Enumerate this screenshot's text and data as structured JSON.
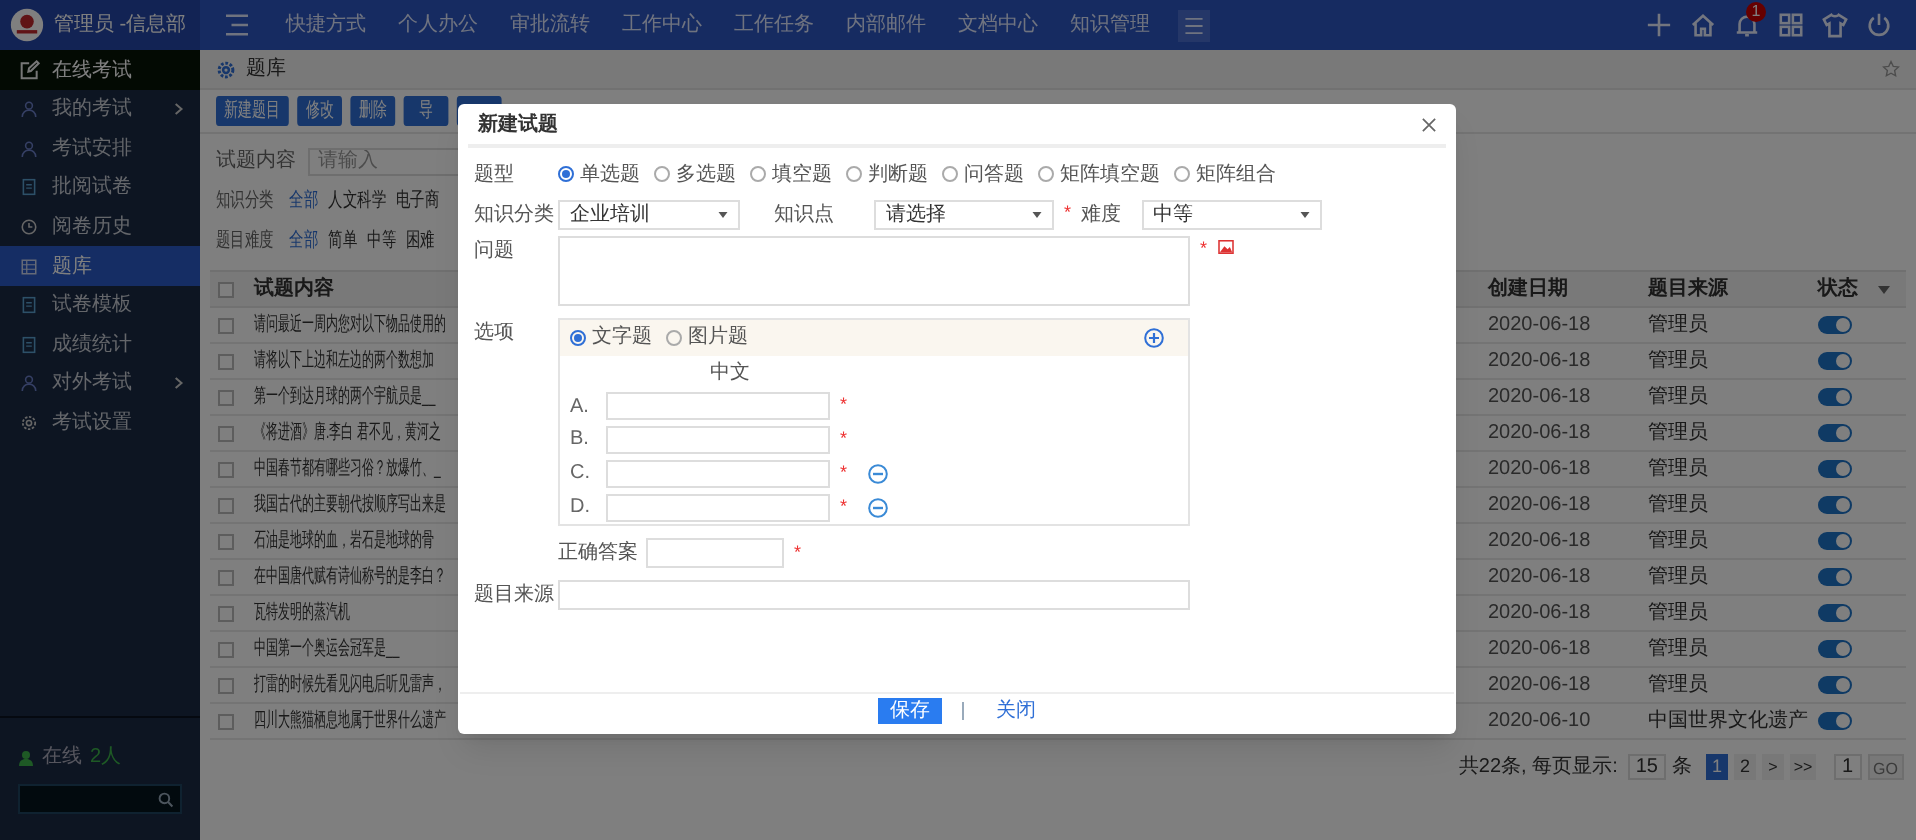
{
  "header": {
    "brand": "管理员 -信息部",
    "nav": [
      "快捷方式",
      "个人办公",
      "审批流转",
      "工作中心",
      "工作任务",
      "内部邮件",
      "文档中心",
      "知识管理"
    ],
    "notification_count": "1"
  },
  "sidebar": {
    "title": "在线考试",
    "items": [
      {
        "label": "我的考试",
        "expandable": true,
        "selected": false
      },
      {
        "label": "考试安排",
        "expandable": false,
        "selected": false
      },
      {
        "label": "批阅试卷",
        "expandable": false,
        "selected": false
      },
      {
        "label": "阅卷历史",
        "expandable": false,
        "selected": false
      },
      {
        "label": "题库",
        "expandable": false,
        "selected": true
      },
      {
        "label": "试卷模板",
        "expandable": false,
        "selected": false
      },
      {
        "label": "成绩统计",
        "expandable": false,
        "selected": false
      },
      {
        "label": "对外考试",
        "expandable": true,
        "selected": false
      },
      {
        "label": "考试设置",
        "expandable": false,
        "selected": false
      }
    ],
    "online_label": "在线",
    "online_count": "2人"
  },
  "breadcrumb": "题库",
  "toolbar": [
    {
      "label": "新建题目"
    },
    {
      "label": "修改"
    },
    {
      "label": "删除"
    },
    {
      "label": "导"
    }
  ],
  "filters": {
    "content_label": "试题内容",
    "content_placeholder": "请输入",
    "groups": [
      {
        "label": "知识分类",
        "options": [
          {
            "label": "全部",
            "selected": true
          },
          {
            "label": "人文科学",
            "selected": false
          },
          {
            "label": "电子商",
            "selected": false
          }
        ]
      },
      {
        "label": "题目难度",
        "options": [
          {
            "label": "全部",
            "selected": true
          },
          {
            "label": "简单",
            "selected": false
          },
          {
            "label": "中等",
            "selected": false
          },
          {
            "label": "困难",
            "selected": false
          }
        ]
      }
    ]
  },
  "table": {
    "all_checked": false,
    "columns": [
      "试题内容",
      "创建日期",
      "题目来源",
      "状态"
    ],
    "rows": [
      {
        "content": "请问最近一周内您对以下物品使用的",
        "date": "2020-06-18",
        "source": "管理员",
        "on": true,
        "checked": false
      },
      {
        "content": "请将以下上边和左边的两个数想加",
        "date": "2020-06-18",
        "source": "管理员",
        "on": true,
        "checked": false
      },
      {
        "content": "第一个到达月球的两个宇航员是__",
        "date": "2020-06-18",
        "source": "管理员",
        "on": true,
        "checked": false
      },
      {
        "content": "《将进酒》唐.李白 君不见，黄河之",
        "date": "2020-06-18",
        "source": "管理员",
        "on": true,
        "checked": false
      },
      {
        "content": "中国春节都有哪些习俗？放爆竹、_",
        "date": "2020-06-18",
        "source": "管理员",
        "on": true,
        "checked": false
      },
      {
        "content": "我国古代的主要朝代按顺序写出来是",
        "date": "2020-06-18",
        "source": "管理员",
        "on": true,
        "checked": false
      },
      {
        "content": "石油是地球的血，岩石是地球的骨",
        "date": "2020-06-18",
        "source": "管理员",
        "on": true,
        "checked": false
      },
      {
        "content": "在中国唐代赋有诗仙称号的是李白？",
        "date": "2020-06-18",
        "source": "管理员",
        "on": true,
        "checked": false
      },
      {
        "content": "瓦特发明的蒸汽机",
        "date": "2020-06-18",
        "source": "管理员",
        "on": true,
        "checked": false
      },
      {
        "content": "中国第一个奥运会冠军是__",
        "date": "2020-06-18",
        "source": "管理员",
        "on": true,
        "checked": false
      },
      {
        "content": "打雷的时候先看见闪电后听见雷声，",
        "date": "2020-06-18",
        "source": "管理员",
        "on": true,
        "checked": false
      },
      {
        "content": "四川大熊猫栖息地属于世界什么遗产",
        "date": "2020-06-10",
        "source": "中国世界文化遗产",
        "on": true,
        "checked": false
      }
    ]
  },
  "pagination": {
    "summary": "共22条, 每页显示:",
    "page_size": "15",
    "unit": "条",
    "pages": [
      {
        "label": "1",
        "selected": true
      },
      {
        "label": "2",
        "selected": false
      }
    ],
    "next": ">",
    "last": ">>",
    "jump_value": "1",
    "go": "GO"
  },
  "dialog": {
    "title": "新建试题",
    "type_label": "题型",
    "types": [
      {
        "label": "单选题",
        "selected": true
      },
      {
        "label": "多选题",
        "selected": false
      },
      {
        "label": "填空题",
        "selected": false
      },
      {
        "label": "判断题",
        "selected": false
      },
      {
        "label": "问答题",
        "selected": false
      },
      {
        "label": "矩阵填空题",
        "selected": false
      },
      {
        "label": "矩阵组合",
        "selected": false
      }
    ],
    "category_label": "知识分类",
    "category_value": "企业培训",
    "point_label": "知识点",
    "point_value": "请选择",
    "point_required": "*",
    "question_required": "*",
    "answer_required": "*",
    "difficulty_label": "难度",
    "difficulty_value": "中等",
    "question_label": "问题",
    "options_label": "选项",
    "option_modes": [
      {
        "label": "文字题",
        "selected": true
      },
      {
        "label": "图片题",
        "selected": false
      }
    ],
    "language_heading": "中文",
    "options": [
      {
        "letter": "A.",
        "required": "*",
        "removable": false
      },
      {
        "letter": "B.",
        "required": "*",
        "removable": false
      },
      {
        "letter": "C.",
        "required": "*",
        "removable": true
      },
      {
        "letter": "D.",
        "required": "*",
        "removable": true
      }
    ],
    "answer_label": "正确答案",
    "source_label": "题目来源",
    "save": "保存",
    "close": "关闭"
  }
}
